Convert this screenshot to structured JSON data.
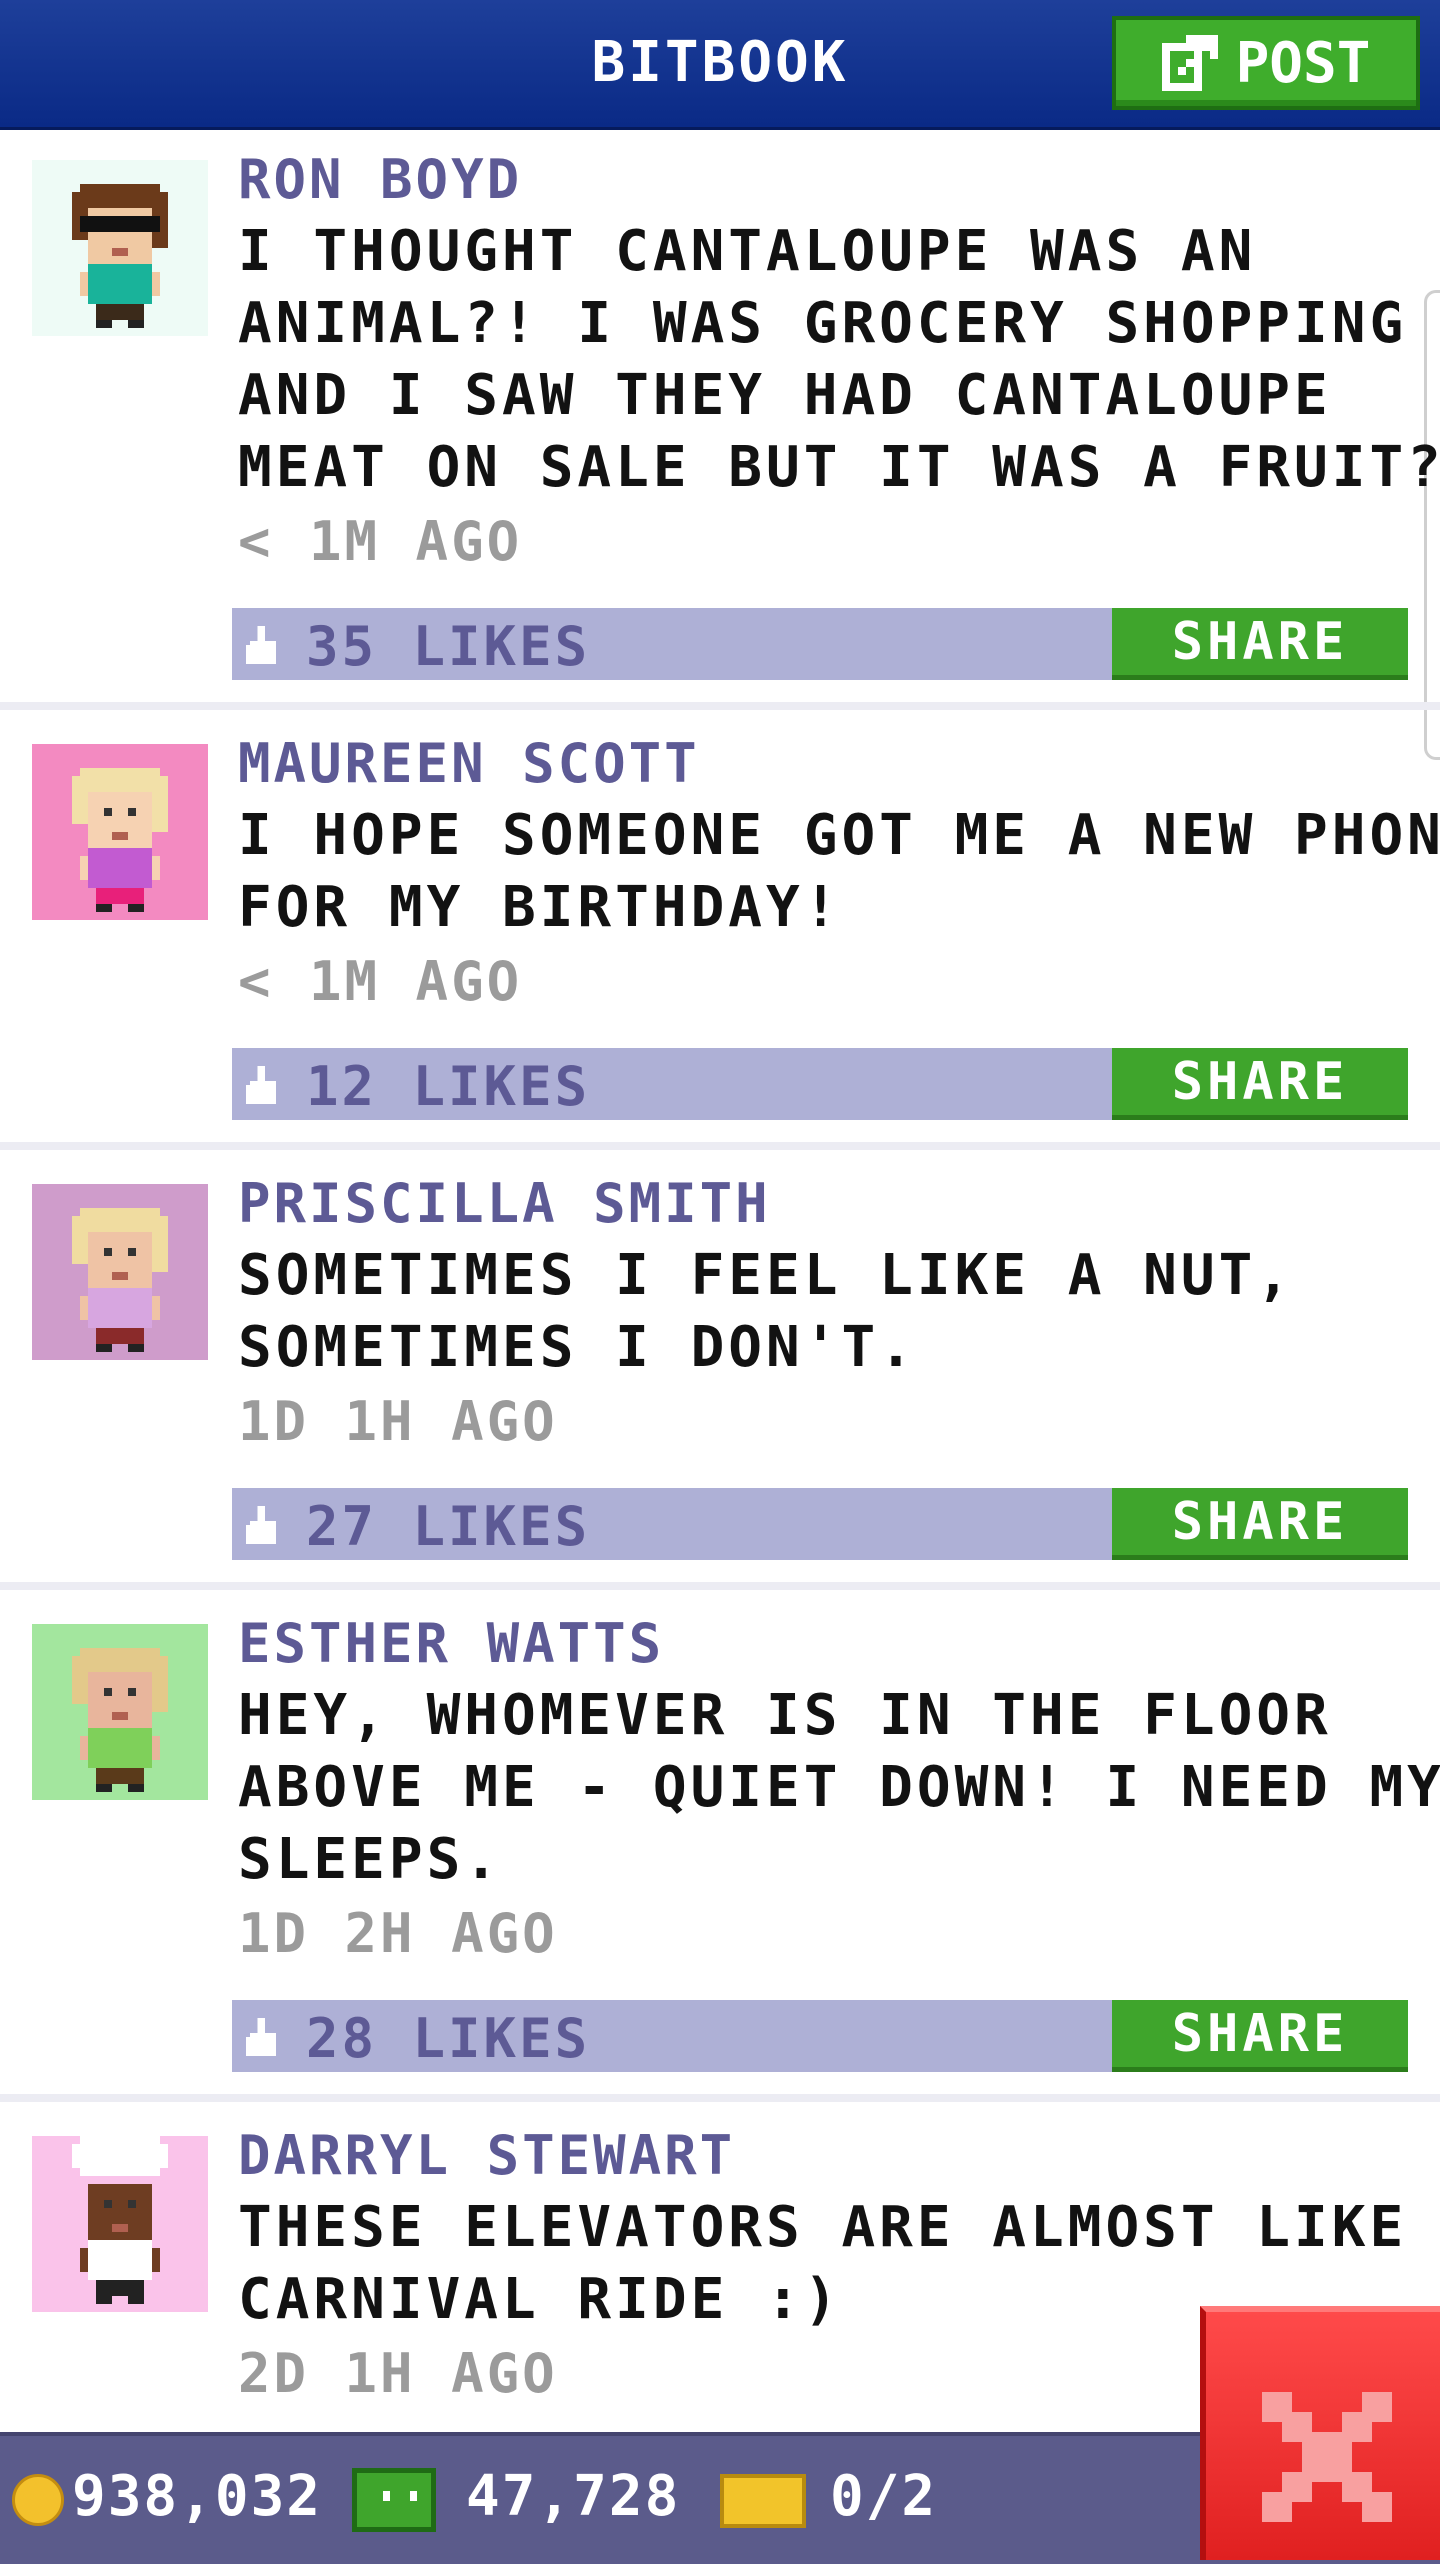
{
  "header": {
    "title": "BITBOOK",
    "post_label": "POST",
    "post_icon": "edit-icon"
  },
  "posts": [
    {
      "author": "RON BOYD",
      "message_lines": [
        "I THOUGHT CANTALOUPE WAS AN",
        "ANIMAL?! I WAS GROCERY SHOPPING",
        "AND I SAW THEY HAD CANTALOUPE",
        "MEAT ON SALE BUT IT WAS A FRUIT?"
      ],
      "time": "< 1M AGO",
      "likes": "35 LIKES",
      "share": "SHARE",
      "avatar": {
        "bg": "#eefbf6",
        "hair": "#6b3a1a",
        "skin": "#f0c9a3",
        "shirt": "#19b39a",
        "pants": "#3b2a1a",
        "glasses": true
      }
    },
    {
      "author": "MAUREEN SCOTT",
      "message_lines": [
        "I HOPE SOMEONE GOT ME A NEW PHONE",
        "FOR MY BIRTHDAY!"
      ],
      "time": "< 1M AGO",
      "likes": "12 LIKES",
      "share": "SHARE",
      "avatar": {
        "bg": "#f38ac1",
        "hair": "#f2e0a8",
        "skin": "#f6d2b2",
        "shirt": "#c25bd1",
        "pants": "#e8207a",
        "glasses": false
      }
    },
    {
      "author": "PRISCILLA SMITH",
      "message_lines": [
        "SOMETIMES I FEEL LIKE A NUT,",
        "SOMETIMES I DON'T."
      ],
      "time": "1D 1H AGO",
      "likes": "27 LIKES",
      "share": "SHARE",
      "avatar": {
        "bg": "#cf9ccb",
        "hair": "#f0dca0",
        "skin": "#efc3a5",
        "shirt": "#d7a6e0",
        "pants": "#8a2a2a",
        "glasses": false
      }
    },
    {
      "author": "ESTHER WATTS",
      "message_lines": [
        "HEY, WHOMEVER IS IN THE FLOOR",
        "ABOVE ME - QUIET DOWN! I NEED MY",
        "SLEEPS."
      ],
      "time": "1D 2H AGO",
      "likes": "28 LIKES",
      "share": "SHARE",
      "avatar": {
        "bg": "#a3e69e",
        "hair": "#e3c98a",
        "skin": "#e8b59c",
        "shirt": "#7fd05a",
        "pants": "#5a3a1a",
        "glasses": false
      }
    },
    {
      "author": "DARRYL STEWART",
      "message_lines": [
        "THESE ELEVATORS ARE ALMOST LIKE A",
        "CARNIVAL RIDE :)"
      ],
      "time": "2D 1H AGO",
      "likes": "",
      "share": "",
      "avatar": {
        "bg": "#fac3ea",
        "hair": "#ffffff",
        "skin": "#6e3d22",
        "shirt": "#ffffff",
        "pants": "#222222",
        "glasses": false,
        "chef": true
      }
    }
  ],
  "bottom_bar": {
    "coins": "938,032",
    "cash": "47,728",
    "tickets": "0/2",
    "coin_icon": "coin-icon",
    "cash_icon": "bux-icon",
    "ticket_icon": "ticket-icon"
  },
  "close_icon": "close-icon",
  "colors": {
    "header": "#0a2a86",
    "author": "#5d5a95",
    "likes_bar": "#aeb0d6",
    "share": "#3fa52c",
    "bottom_bar": "#5b5b8b",
    "close": "#e02020"
  }
}
